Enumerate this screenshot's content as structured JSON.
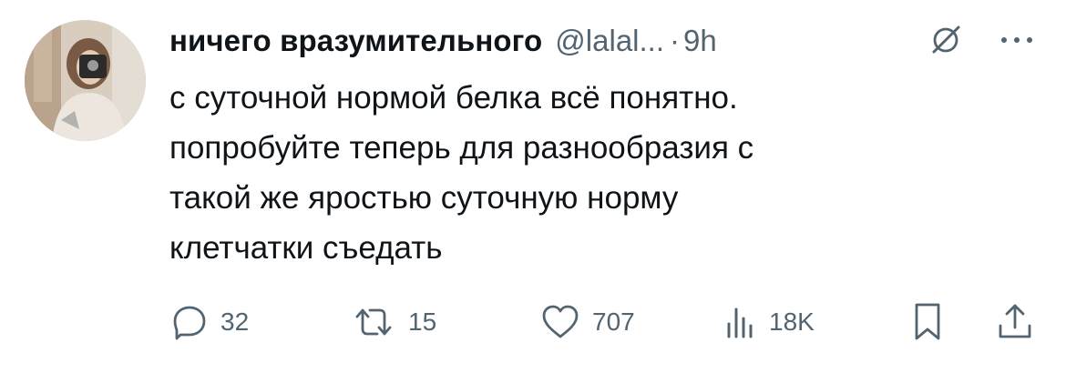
{
  "tweet": {
    "author": {
      "display_name": "ничего вразумительного",
      "handle": "@lalal...",
      "separator": "·",
      "time": "9h"
    },
    "text_lines": [
      "с суточной нормой белка всё понятно.",
      "попробуйте теперь для разнообразия с",
      "такой же яростью суточную норму",
      "клетчатки съедать"
    ],
    "actions": {
      "replies": "32",
      "retweets": "15",
      "likes": "707",
      "views": "18K"
    }
  },
  "colors": {
    "text": "#0f1419",
    "secondary": "#536471"
  },
  "icons": {
    "grok": "grok-icon",
    "more": "more-icon",
    "reply": "reply-icon",
    "retweet": "retweet-icon",
    "like": "heart-icon",
    "views": "views-icon",
    "bookmark": "bookmark-icon",
    "share": "share-icon"
  }
}
